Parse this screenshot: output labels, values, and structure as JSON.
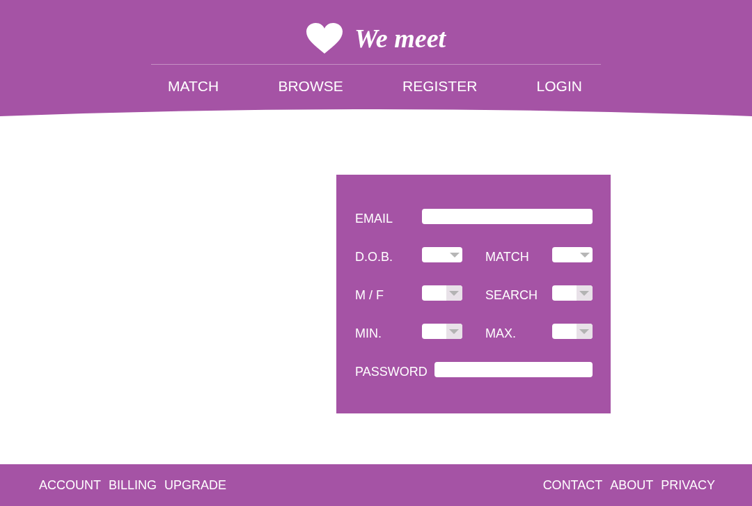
{
  "header": {
    "logo": {
      "text": "We meet"
    },
    "nav": [
      {
        "label": "MATCH"
      },
      {
        "label": "BROWSE"
      },
      {
        "label": "REGISTER"
      },
      {
        "label": "LOGIN"
      }
    ]
  },
  "form": {
    "rows": [
      {
        "fields": [
          {
            "kind": "input",
            "label": "EMAIL"
          }
        ]
      },
      {
        "fields": [
          {
            "kind": "dropdown",
            "label": "D.O.B."
          },
          {
            "kind": "dropdown",
            "label": "MATCH"
          }
        ]
      },
      {
        "fields": [
          {
            "kind": "split-dropdown",
            "label": "M / F"
          },
          {
            "kind": "split-dropdown",
            "label": "SEARCH"
          }
        ]
      },
      {
        "fields": [
          {
            "kind": "split-dropdown",
            "label": "MIN."
          },
          {
            "kind": "split-dropdown",
            "label": "MAX."
          }
        ]
      },
      {
        "fields": [
          {
            "kind": "input",
            "label": "PASSWORD"
          }
        ]
      }
    ]
  },
  "footer": {
    "left_links": [
      "ACCOUNT",
      "BILLING",
      "UPGRADE"
    ],
    "right_links": [
      "CONTACT",
      "ABOUT",
      "PRIVACY"
    ]
  }
}
